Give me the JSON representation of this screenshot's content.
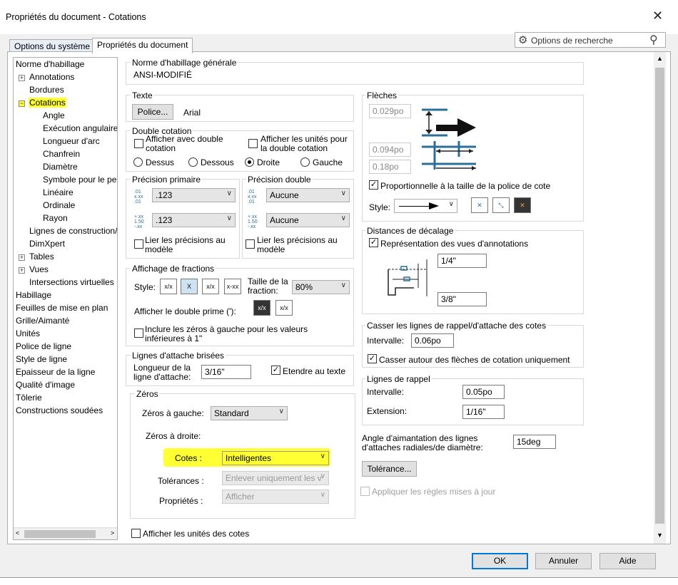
{
  "window": {
    "title": "Propriétés du document - Cotations",
    "close": "✕"
  },
  "tabs": [
    {
      "label": "Options du système"
    },
    {
      "label": "Propriétés du document"
    }
  ],
  "search": {
    "label": "Options de recherche"
  },
  "tree": [
    "Norme d'habillage",
    "Annotations",
    "Bordures",
    "Cotations",
    "Angle",
    "Exécution angulaire",
    "Longueur d'arc",
    "Chanfrein",
    "Diamètre",
    "Symbole pour le perçage",
    "Linéaire",
    "Ordinale",
    "Rayon",
    "Lignes de construction/",
    "DimXpert",
    "Tables",
    "Vues",
    "Intersections virtuelles",
    "Habillage",
    "Feuilles de mise en plan",
    "Grille/Aimanté",
    "Unités",
    "Police de ligne",
    "Style de ligne",
    "Epaisseur de la ligne",
    "Qualité d'image",
    "Tôlerie",
    "Constructions soudées"
  ],
  "norme": {
    "label": "Norme d'habillage générale",
    "value": "ANSI-MODIFIÉ"
  },
  "texte": {
    "label": "Texte",
    "font_button": "Police...",
    "font_name": "Arial"
  },
  "double": {
    "label": "Double cotation",
    "chk1": "Afficher avec double cotation",
    "chk2": "Afficher les unités pour la double cotation",
    "r1": "Dessus",
    "r2": "Dessous",
    "r3": "Droite",
    "r4": "Gauche"
  },
  "precision": {
    "primary_label": "Précision primaire",
    "p1": ".123",
    "p2": ".123",
    "dual_label": "Précision double",
    "d1": "Aucune",
    "d2": "Aucune",
    "link": "Lier les précisions au modèle",
    "link2": "Lier les précisions au modèle"
  },
  "fractions": {
    "label": "Affichage de fractions",
    "style": "Style:",
    "size_label": "Taille de la fraction:",
    "size_value": "80%",
    "prime": "Afficher le double prime ('):",
    "zeros": "Inclure les zéros à gauche pour les valeurs inférieures à 1\""
  },
  "broken": {
    "label": "Lignes d'attache brisées",
    "len_label": "Longueur de la ligne d'attache:",
    "len_value": "3/16\"",
    "extend": "Etendre au texte"
  },
  "zeros": {
    "label": "Zéros",
    "left_label": "Zéros à gauche:",
    "left_value": "Standard",
    "right_label": "Zéros à droite:",
    "cotes_label": "Cotes :",
    "cotes_value": "Intelligentes",
    "tol_label": "Tolérances :",
    "tol_value": "Enlever uniquement les v",
    "prop_label": "Propriétés :",
    "prop_value": "Afficher"
  },
  "show_units": "Afficher les unités des cotes",
  "fleches": {
    "label": "Flèches",
    "v1": "0.029po",
    "v2": "0.094po",
    "v3": "0.18po",
    "prop": "Proportionnelle à la taille de la police de cote",
    "style": "Style:"
  },
  "decalage": {
    "label": "Distances de décalage",
    "chk": "Représentation des vues d'annotations",
    "v1": "1/4\"",
    "v2": "3/8\""
  },
  "casser": {
    "label": "Casser les lignes de rappel/d'attache des cotes",
    "interval_label": "Intervalle:",
    "interval_value": "0.06po",
    "chk": "Casser autour des flèches de cotation uniquement"
  },
  "rappel": {
    "label": "Lignes de rappel",
    "interval_label": "Intervalle:",
    "interval_value": "0.05po",
    "ext_label": "Extension:",
    "ext_value": "1/16\""
  },
  "angle": {
    "label": "Angle d'aimantation des lignes d'attaches radiales/de diamètre:",
    "value": "15deg"
  },
  "tolerance_button": "Tolérance...",
  "apply_rules": "Appliquer les règles mises à jour",
  "footer": {
    "ok": "OK",
    "cancel": "Annuler",
    "help": "Aide"
  },
  "colors": {
    "highlight": "#ffff33",
    "accent": "#0078d7",
    "arrow_blue": "#2a6f97"
  }
}
